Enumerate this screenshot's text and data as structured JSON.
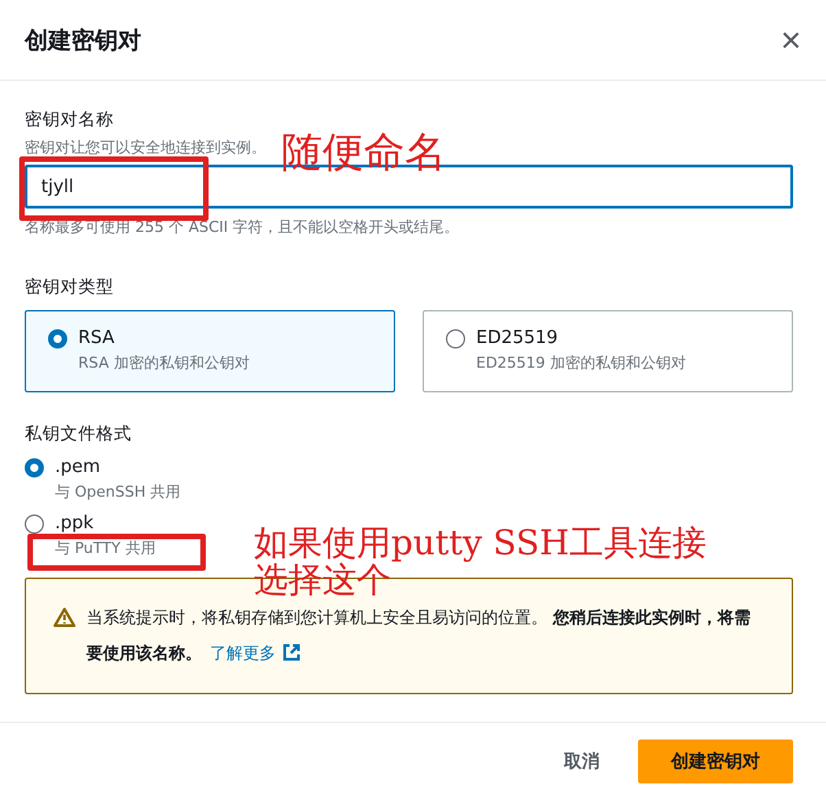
{
  "dialog": {
    "title": "创建密钥对",
    "close": "×"
  },
  "name_field": {
    "label": "密钥对名称",
    "description": "密钥对让您可以安全地连接到实例。",
    "value": "tjyll",
    "hint": "名称最多可使用 255 个 ASCII 字符，且不能以空格开头或结尾。"
  },
  "key_type": {
    "label": "密钥对类型",
    "options": [
      {
        "title": "RSA",
        "description": "RSA 加密的私钥和公钥对",
        "selected": true
      },
      {
        "title": "ED25519",
        "description": "ED25519 加密的私钥和公钥对",
        "selected": false
      }
    ]
  },
  "file_format": {
    "label": "私钥文件格式",
    "options": [
      {
        "title": ".pem",
        "description": "与 OpenSSH 共用",
        "selected": true
      },
      {
        "title": ".ppk",
        "description": "与 PuTTY 共用",
        "selected": false
      }
    ]
  },
  "alert": {
    "text": "当系统提示时，将私钥存储到您计算机上安全且易访问的位置。 **您稍后连接此实例时，将需要使用该名称。**",
    "link": "了解更多"
  },
  "buttons": [
    {
      "label": "取消",
      "kind": "secondary"
    },
    {
      "label": "创建密钥对",
      "kind": "primary"
    }
  ],
  "annotations": [
    {
      "text": "随便命名"
    },
    {
      "text": "如果使用putty SSH工具连接"
    },
    {
      "text": "选择这个"
    }
  ]
}
